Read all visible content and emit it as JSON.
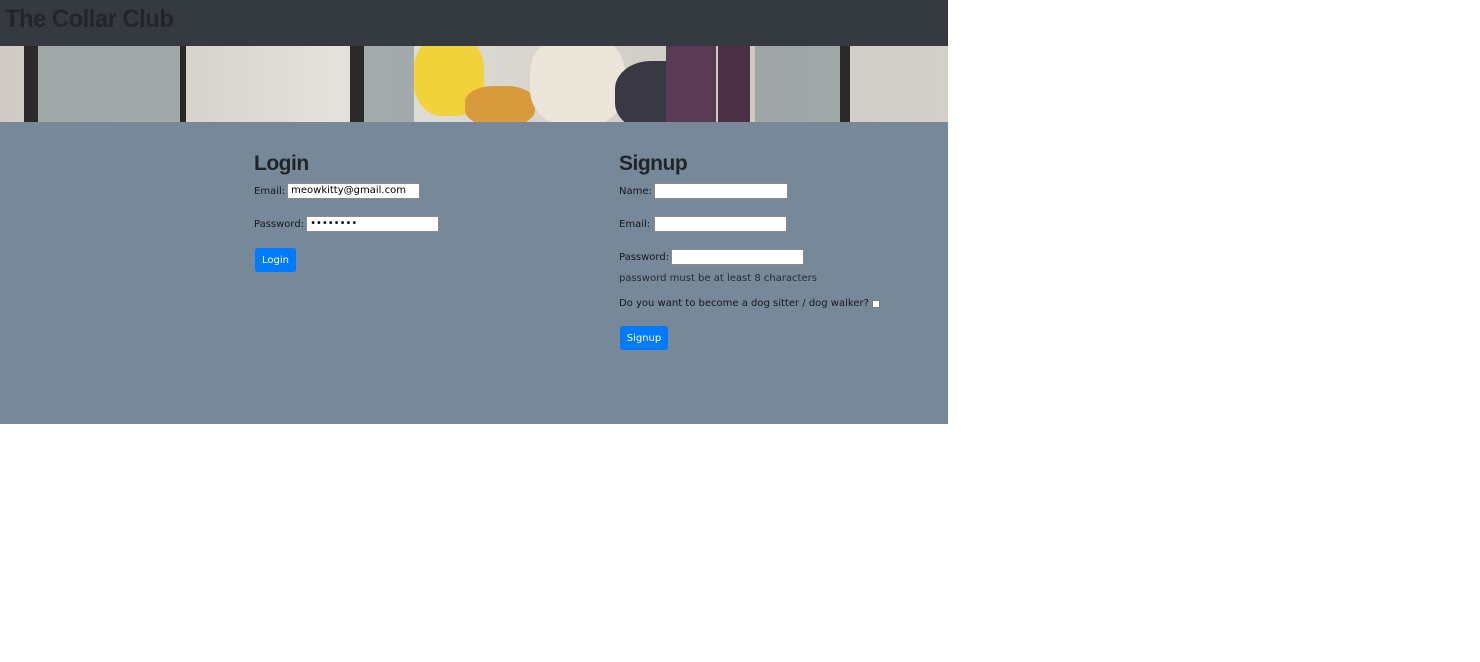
{
  "app": {
    "title": "The Collar Club"
  },
  "colors": {
    "navbar": "#343a40",
    "main_bg": "#778899",
    "primary": "#007bff"
  },
  "banner": {
    "icon": "dogs-photo"
  },
  "login": {
    "heading": "Login",
    "email_label": "Email:",
    "email_value": "meowkitty@gmail.com",
    "password_label": "Password:",
    "password_value": "••••••••",
    "button": "Login"
  },
  "signup": {
    "heading": "Signup",
    "name_label": "Name:",
    "name_value": "",
    "email_label": "Email:",
    "email_value": "",
    "password_label": "Password:",
    "password_value": "",
    "password_hint": "password must be at least 8 characters",
    "sitter_label": "Do you want to become a dog sitter / dog walker?",
    "sitter_checked": false,
    "button": "Signup"
  }
}
